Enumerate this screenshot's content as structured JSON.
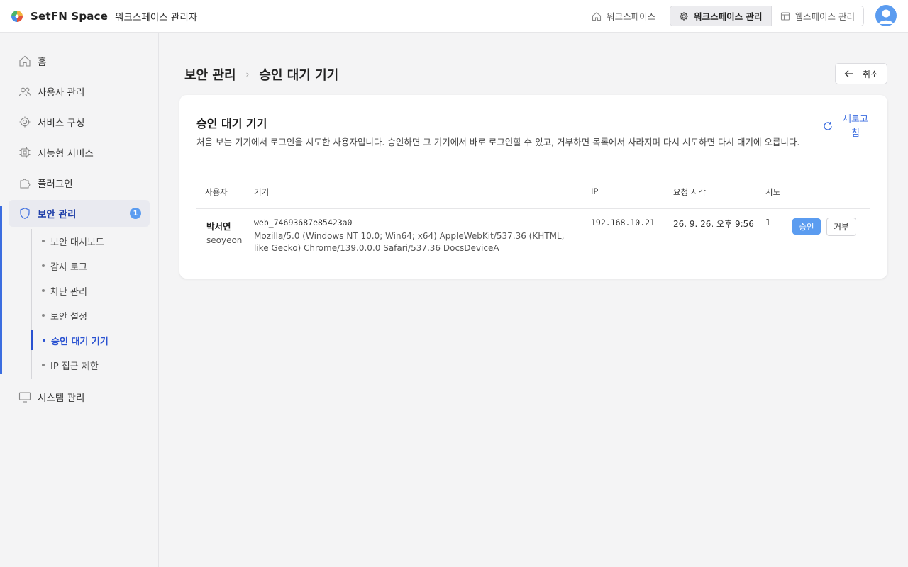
{
  "header": {
    "brand_name": "SetFN Space",
    "brand_sub": "워크스페이스 관리자",
    "nav_workspace": "워크스페이스",
    "nav_workspace_admin": "워크스페이스 관리",
    "nav_webspace_admin": "웹스페이스 관리"
  },
  "sidebar": {
    "items": [
      {
        "label": "홈",
        "icon": "home-icon"
      },
      {
        "label": "사용자 관리",
        "icon": "users-icon"
      },
      {
        "label": "서비스 구성",
        "icon": "gear-icon"
      },
      {
        "label": "지능형 서비스",
        "icon": "chip-icon"
      },
      {
        "label": "플러그인",
        "icon": "puzzle-icon"
      },
      {
        "label": "보안 관리",
        "icon": "shield-icon",
        "badge": "1"
      },
      {
        "label": "시스템 관리",
        "icon": "monitor-icon"
      }
    ],
    "security_sub": [
      "보안 대시보드",
      "감사 로그",
      "차단 관리",
      "보안 설정",
      "승인 대기 기기",
      "IP 접근 제한"
    ]
  },
  "breadcrumb": {
    "parent": "보안 관리",
    "current": "승인 대기 기기"
  },
  "cancel_label": "취소",
  "card": {
    "title": "승인 대기 기기",
    "description": "처음 보는 기기에서 로그인을 시도한 사용자입니다. 승인하면 그 기기에서 바로 로그인할 수 있고, 거부하면 목록에서 사라지며 다시 시도하면 다시 대기에 오릅니다.",
    "refresh_label": "새로고침"
  },
  "table": {
    "headers": [
      "사용자",
      "기기",
      "IP",
      "요청 시각",
      "시도"
    ],
    "rows": [
      {
        "user_name": "박서연",
        "user_id": "seoyeon",
        "device_id": "web_74693687e85423a0",
        "user_agent": "Mozilla/5.0 (Windows NT 10.0; Win64; x64) AppleWebKit/537.36 (KHTML, like Gecko) Chrome/139.0.0.0 Safari/537.36 DocsDeviceA",
        "ip": "192.168.10.21",
        "requested_at": "26. 9. 26. 오후 9:56",
        "attempts": "1",
        "approve_label": "승인",
        "reject_label": "거부"
      }
    ]
  },
  "colors": {
    "accent": "#3b6de0",
    "badge": "#5b9cf0",
    "approve": "#5b9cf0"
  }
}
